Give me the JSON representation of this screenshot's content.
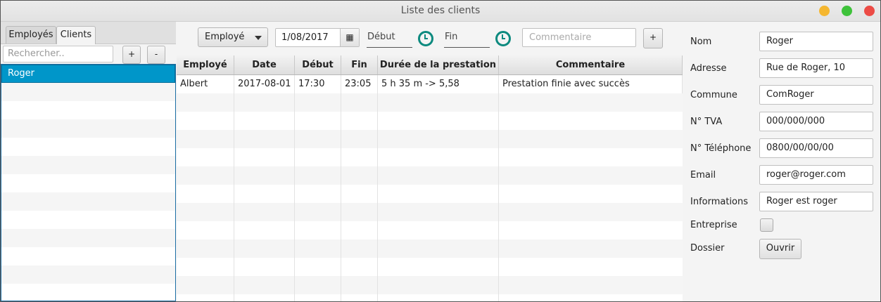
{
  "window": {
    "title": "Liste des clients"
  },
  "left": {
    "tabs": [
      "Employés",
      "Clients"
    ],
    "search_placeholder": "Rechercher..",
    "add_label": "+",
    "remove_label": "-",
    "clients": [
      "Roger"
    ]
  },
  "toolbar": {
    "employee_select": "Employé",
    "date_value": "1/08/2017",
    "start_placeholder": "Début",
    "end_placeholder": "Fin",
    "comment_placeholder": "Commentaire",
    "add_label": "+"
  },
  "table": {
    "columns": [
      "Employé",
      "Date",
      "Début",
      "Fin",
      "Durée de la prestation",
      "Commentaire"
    ],
    "rows": [
      [
        "Albert",
        "2017-08-01",
        "17:30",
        "23:05",
        "5 h 35 m -> 5,58",
        "Prestation finie avec succès"
      ]
    ]
  },
  "details": {
    "nom_label": "Nom",
    "nom": "Roger",
    "adresse_label": "Adresse",
    "adresse": "Rue de Roger, 10",
    "commune_label": "Commune",
    "commune": "ComRoger",
    "tva_label": "N° TVA",
    "tva": "000/000/000",
    "tel_label": "N° Téléphone",
    "tel": "0800/00/00/00",
    "email_label": "Email",
    "email": "roger@roger.com",
    "info_label": "Informations",
    "info": "Roger est roger",
    "entreprise_label": "Entreprise",
    "dossier_label": "Dossier",
    "ouvrir_label": "Ouvrir"
  },
  "colors": {
    "selection": "#0096c9",
    "clock": "#0d8a7f"
  }
}
